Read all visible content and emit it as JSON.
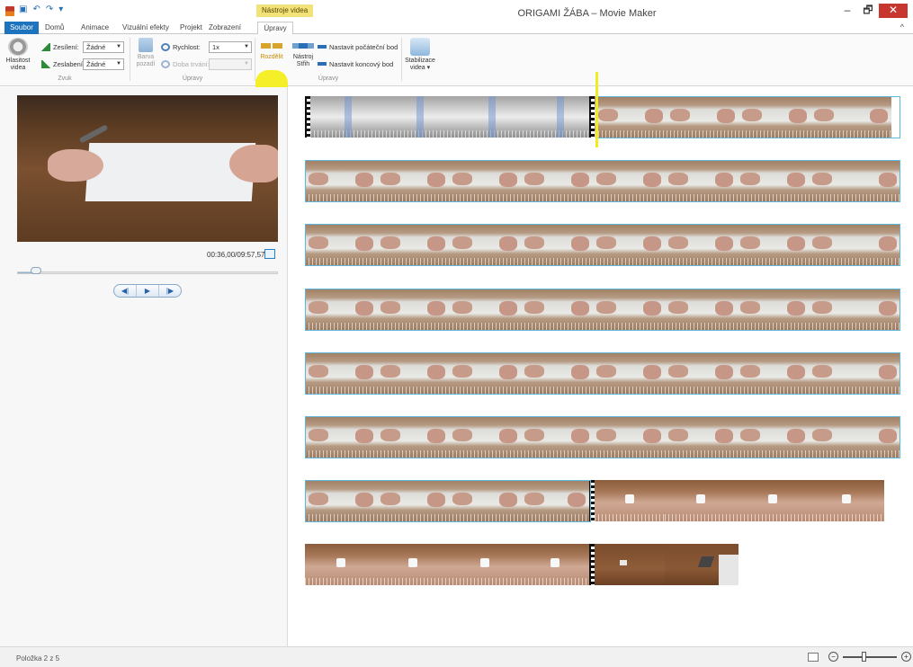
{
  "title_bar": {
    "window_title": "ORIGAMI ŽÁBA – Movie Maker",
    "context_tab_label": "Nástroje videa",
    "minimize": "–",
    "maximize": "🗗",
    "close": "✕"
  },
  "tabs": {
    "file": "Soubor",
    "home": "Domů",
    "animations": "Animace",
    "visual_effects": "Vizuální efekty",
    "project": "Projekt",
    "view": "Zobrazení",
    "edit": "Úpravy"
  },
  "ribbon": {
    "volume_label_line1": "Hlasitost",
    "volume_label_line2": "videa",
    "fade_in_label": "Zesílení:",
    "fade_in_value": "Žádné",
    "fade_out_label": "Zeslabení:",
    "fade_out_value": "Žádné",
    "group_audio": "Zvuk",
    "bg_color_line1": "Barva",
    "bg_color_line2": "pozadí",
    "speed_label": "Rychlost:",
    "speed_value": "1x",
    "duration_label": "Doba trvání:",
    "duration_value": "",
    "group_edit_1": "Úpravy",
    "split_label": "Rozdělit",
    "trim_line1": "Nástroj",
    "trim_line2": "Střih",
    "set_start": "Nastavit počáteční bod",
    "set_end": "Nastavit koncový bod",
    "group_edit_2": "Úpravy",
    "stabilize_line1": "Stabilizace",
    "stabilize_line2": "videa"
  },
  "preview": {
    "time_readout": "00:36,00/09:57,57",
    "position_fraction": 0.06
  },
  "status_bar": {
    "item_text": "Položka 2 z 5",
    "zoom_out": "−",
    "zoom_in": "+"
  },
  "colors": {
    "accent": "#1e73be",
    "highlight": "#f5ef2a",
    "selection": "#5fb6da"
  }
}
